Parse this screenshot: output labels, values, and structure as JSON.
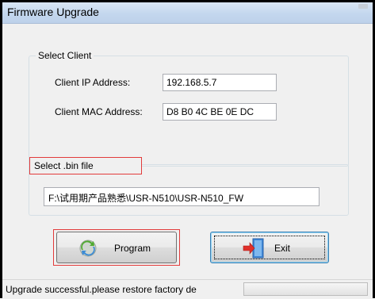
{
  "window": {
    "title": "Firmware Upgrade"
  },
  "client_group": {
    "caption": "Select Client",
    "ip_label": "Client IP Address:",
    "ip_value": "192.168.5.7",
    "mac_label": "Client MAC Address:",
    "mac_value": "D8 B0 4C BE 0E DC"
  },
  "bin_group": {
    "caption": "Select .bin file",
    "path_value": "F:\\试用期产品熟悉\\USR-N510\\USR-N510_FW"
  },
  "buttons": {
    "program_label": "Program",
    "program_icon": "gear-refresh-icon",
    "exit_label": "Exit",
    "exit_icon": "exit-door-icon"
  },
  "status": {
    "text": "Upgrade successful.please restore factory de"
  },
  "colors": {
    "highlight_box": "#e23b3b",
    "titlebar": "#c4d7ee",
    "dialog_bg": "#f0f0f0"
  }
}
